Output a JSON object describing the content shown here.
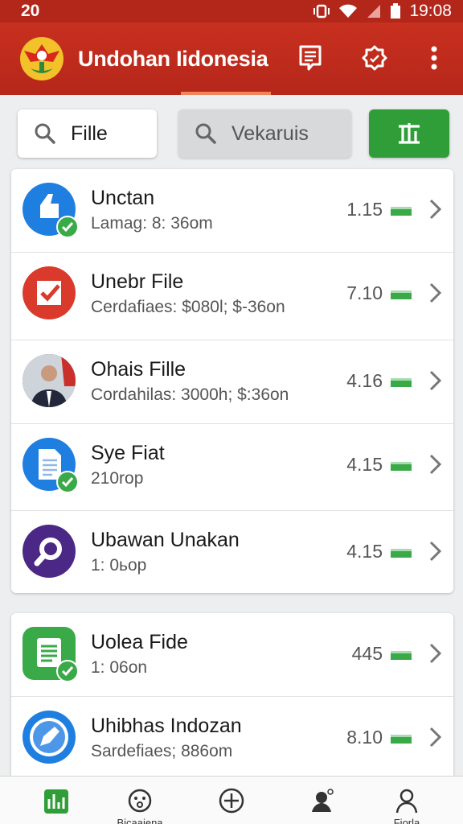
{
  "status_bar": {
    "left_number": "20",
    "time": "19:08"
  },
  "app": {
    "title": "Undohan Iidonesia"
  },
  "toolbar": {
    "search_primary": "Fille",
    "search_secondary": "Vekaruis"
  },
  "items": [
    {
      "title": "Unctan",
      "subtitle": "Lamag: 8: 36om",
      "value": "1.15",
      "icon": "thumbs-up-icon",
      "color": "#1f7fe0",
      "checked": true
    },
    {
      "title": "Unebr File",
      "subtitle": "Cerdafiaes: $080l; $-36on",
      "value": "7.10",
      "icon": "checkbox-icon",
      "color": "#d93a2b",
      "checked": false
    },
    {
      "title": "Ohais Fille",
      "subtitle": "Cordahilas: 3000h; $:36on",
      "value": "4.16",
      "icon": "person-photo-icon",
      "color": "#555555",
      "checked": false
    },
    {
      "title": "Sye Fiat",
      "subtitle": "210rop",
      "value": "4.15",
      "icon": "document-icon",
      "color": "#1f7fe0",
      "checked": true
    },
    {
      "title": "Ubawan Unakan",
      "subtitle": "1: 0ьop",
      "value": "4.15",
      "icon": "magnifier-icon",
      "color": "#4b2885",
      "checked": false
    },
    {
      "title": "Uolea Fide",
      "subtitle": "1: 06on",
      "value": "445",
      "icon": "spreadsheet-icon",
      "color": "#3aa948",
      "checked": true
    },
    {
      "title": "Uhibhas Indozan",
      "subtitle": "Sardefiaes; 886om",
      "value": "8.10",
      "icon": "pen-icon",
      "color": "#1f7fe0",
      "checked": false
    }
  ],
  "bottom_nav": [
    {
      "label": "",
      "icon": "chart-icon"
    },
    {
      "label": "Bicaaiena",
      "icon": "face-icon"
    },
    {
      "label": "",
      "icon": "add-circle-icon"
    },
    {
      "label": "",
      "icon": "user-badge-icon"
    },
    {
      "label": "Fiorla",
      "icon": "profile-icon"
    }
  ],
  "colors": {
    "brand": "#c3291d",
    "accent": "#2f9e38",
    "tab_indicator": "#f0855a"
  }
}
